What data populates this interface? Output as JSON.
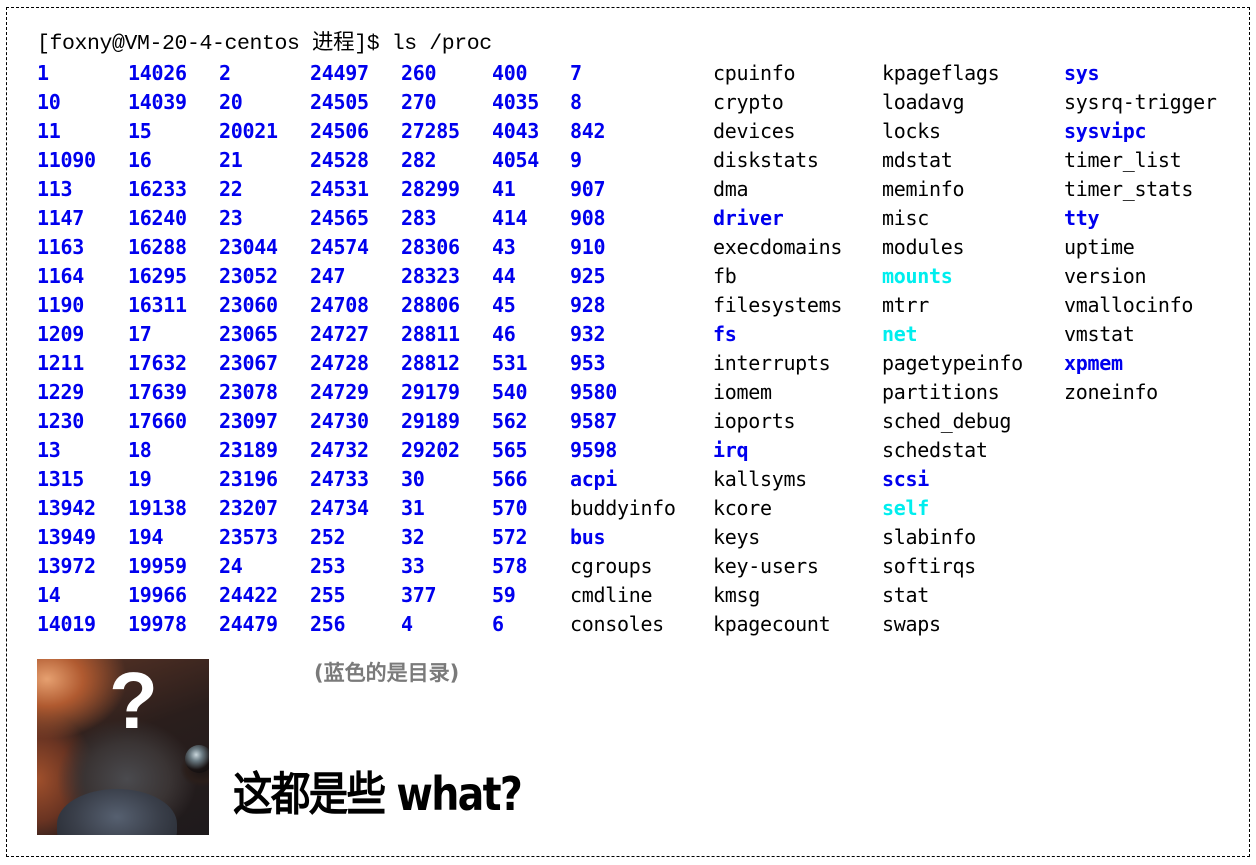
{
  "terminal": {
    "prompt": "[foxny@VM-20-4-centos 进程]$ ls /proc",
    "colors": {
      "file": "#000000",
      "directory": "#0000ee",
      "symlink": "#00eeee"
    },
    "columns": [
      [
        {
          "name": "1",
          "type": "dir"
        },
        {
          "name": "10",
          "type": "dir"
        },
        {
          "name": "11",
          "type": "dir"
        },
        {
          "name": "11090",
          "type": "dir"
        },
        {
          "name": "113",
          "type": "dir"
        },
        {
          "name": "1147",
          "type": "dir"
        },
        {
          "name": "1163",
          "type": "dir"
        },
        {
          "name": "1164",
          "type": "dir"
        },
        {
          "name": "1190",
          "type": "dir"
        },
        {
          "name": "1209",
          "type": "dir"
        },
        {
          "name": "1211",
          "type": "dir"
        },
        {
          "name": "1229",
          "type": "dir"
        },
        {
          "name": "1230",
          "type": "dir"
        },
        {
          "name": "13",
          "type": "dir"
        },
        {
          "name": "1315",
          "type": "dir"
        },
        {
          "name": "13942",
          "type": "dir"
        },
        {
          "name": "13949",
          "type": "dir"
        },
        {
          "name": "13972",
          "type": "dir"
        },
        {
          "name": "14",
          "type": "dir"
        },
        {
          "name": "14019",
          "type": "dir"
        }
      ],
      [
        {
          "name": "14026",
          "type": "dir"
        },
        {
          "name": "14039",
          "type": "dir"
        },
        {
          "name": "15",
          "type": "dir"
        },
        {
          "name": "16",
          "type": "dir"
        },
        {
          "name": "16233",
          "type": "dir"
        },
        {
          "name": "16240",
          "type": "dir"
        },
        {
          "name": "16288",
          "type": "dir"
        },
        {
          "name": "16295",
          "type": "dir"
        },
        {
          "name": "16311",
          "type": "dir"
        },
        {
          "name": "17",
          "type": "dir"
        },
        {
          "name": "17632",
          "type": "dir"
        },
        {
          "name": "17639",
          "type": "dir"
        },
        {
          "name": "17660",
          "type": "dir"
        },
        {
          "name": "18",
          "type": "dir"
        },
        {
          "name": "19",
          "type": "dir"
        },
        {
          "name": "19138",
          "type": "dir"
        },
        {
          "name": "194",
          "type": "dir"
        },
        {
          "name": "19959",
          "type": "dir"
        },
        {
          "name": "19966",
          "type": "dir"
        },
        {
          "name": "19978",
          "type": "dir"
        }
      ],
      [
        {
          "name": "2",
          "type": "dir"
        },
        {
          "name": "20",
          "type": "dir"
        },
        {
          "name": "20021",
          "type": "dir"
        },
        {
          "name": "21",
          "type": "dir"
        },
        {
          "name": "22",
          "type": "dir"
        },
        {
          "name": "23",
          "type": "dir"
        },
        {
          "name": "23044",
          "type": "dir"
        },
        {
          "name": "23052",
          "type": "dir"
        },
        {
          "name": "23060",
          "type": "dir"
        },
        {
          "name": "23065",
          "type": "dir"
        },
        {
          "name": "23067",
          "type": "dir"
        },
        {
          "name": "23078",
          "type": "dir"
        },
        {
          "name": "23097",
          "type": "dir"
        },
        {
          "name": "23189",
          "type": "dir"
        },
        {
          "name": "23196",
          "type": "dir"
        },
        {
          "name": "23207",
          "type": "dir"
        },
        {
          "name": "23573",
          "type": "dir"
        },
        {
          "name": "24",
          "type": "dir"
        },
        {
          "name": "24422",
          "type": "dir"
        },
        {
          "name": "24479",
          "type": "dir"
        }
      ],
      [
        {
          "name": "24497",
          "type": "dir"
        },
        {
          "name": "24505",
          "type": "dir"
        },
        {
          "name": "24506",
          "type": "dir"
        },
        {
          "name": "24528",
          "type": "dir"
        },
        {
          "name": "24531",
          "type": "dir"
        },
        {
          "name": "24565",
          "type": "dir"
        },
        {
          "name": "24574",
          "type": "dir"
        },
        {
          "name": "247",
          "type": "dir"
        },
        {
          "name": "24708",
          "type": "dir"
        },
        {
          "name": "24727",
          "type": "dir"
        },
        {
          "name": "24728",
          "type": "dir"
        },
        {
          "name": "24729",
          "type": "dir"
        },
        {
          "name": "24730",
          "type": "dir"
        },
        {
          "name": "24732",
          "type": "dir"
        },
        {
          "name": "24733",
          "type": "dir"
        },
        {
          "name": "24734",
          "type": "dir"
        },
        {
          "name": "252",
          "type": "dir"
        },
        {
          "name": "253",
          "type": "dir"
        },
        {
          "name": "255",
          "type": "dir"
        },
        {
          "name": "256",
          "type": "dir"
        }
      ],
      [
        {
          "name": "260",
          "type": "dir"
        },
        {
          "name": "270",
          "type": "dir"
        },
        {
          "name": "27285",
          "type": "dir"
        },
        {
          "name": "282",
          "type": "dir"
        },
        {
          "name": "28299",
          "type": "dir"
        },
        {
          "name": "283",
          "type": "dir"
        },
        {
          "name": "28306",
          "type": "dir"
        },
        {
          "name": "28323",
          "type": "dir"
        },
        {
          "name": "28806",
          "type": "dir"
        },
        {
          "name": "28811",
          "type": "dir"
        },
        {
          "name": "28812",
          "type": "dir"
        },
        {
          "name": "29179",
          "type": "dir"
        },
        {
          "name": "29189",
          "type": "dir"
        },
        {
          "name": "29202",
          "type": "dir"
        },
        {
          "name": "30",
          "type": "dir"
        },
        {
          "name": "31",
          "type": "dir"
        },
        {
          "name": "32",
          "type": "dir"
        },
        {
          "name": "33",
          "type": "dir"
        },
        {
          "name": "377",
          "type": "dir"
        },
        {
          "name": "4",
          "type": "dir"
        }
      ],
      [
        {
          "name": "400",
          "type": "dir"
        },
        {
          "name": "4035",
          "type": "dir"
        },
        {
          "name": "4043",
          "type": "dir"
        },
        {
          "name": "4054",
          "type": "dir"
        },
        {
          "name": "41",
          "type": "dir"
        },
        {
          "name": "414",
          "type": "dir"
        },
        {
          "name": "43",
          "type": "dir"
        },
        {
          "name": "44",
          "type": "dir"
        },
        {
          "name": "45",
          "type": "dir"
        },
        {
          "name": "46",
          "type": "dir"
        },
        {
          "name": "531",
          "type": "dir"
        },
        {
          "name": "540",
          "type": "dir"
        },
        {
          "name": "562",
          "type": "dir"
        },
        {
          "name": "565",
          "type": "dir"
        },
        {
          "name": "566",
          "type": "dir"
        },
        {
          "name": "570",
          "type": "dir"
        },
        {
          "name": "572",
          "type": "dir"
        },
        {
          "name": "578",
          "type": "dir"
        },
        {
          "name": "59",
          "type": "dir"
        },
        {
          "name": "6",
          "type": "dir"
        }
      ],
      [
        {
          "name": "7",
          "type": "dir"
        },
        {
          "name": "8",
          "type": "dir"
        },
        {
          "name": "842",
          "type": "dir"
        },
        {
          "name": "9",
          "type": "dir"
        },
        {
          "name": "907",
          "type": "dir"
        },
        {
          "name": "908",
          "type": "dir"
        },
        {
          "name": "910",
          "type": "dir"
        },
        {
          "name": "925",
          "type": "dir"
        },
        {
          "name": "928",
          "type": "dir"
        },
        {
          "name": "932",
          "type": "dir"
        },
        {
          "name": "953",
          "type": "dir"
        },
        {
          "name": "9580",
          "type": "dir"
        },
        {
          "name": "9587",
          "type": "dir"
        },
        {
          "name": "9598",
          "type": "dir"
        },
        {
          "name": "acpi",
          "type": "dir"
        },
        {
          "name": "buddyinfo",
          "type": "file"
        },
        {
          "name": "bus",
          "type": "dir"
        },
        {
          "name": "cgroups",
          "type": "file"
        },
        {
          "name": "cmdline",
          "type": "file"
        },
        {
          "name": "consoles",
          "type": "file"
        }
      ],
      [
        {
          "name": "cpuinfo",
          "type": "file"
        },
        {
          "name": "crypto",
          "type": "file"
        },
        {
          "name": "devices",
          "type": "file"
        },
        {
          "name": "diskstats",
          "type": "file"
        },
        {
          "name": "dma",
          "type": "file"
        },
        {
          "name": "driver",
          "type": "dir"
        },
        {
          "name": "execdomains",
          "type": "file"
        },
        {
          "name": "fb",
          "type": "file"
        },
        {
          "name": "filesystems",
          "type": "file"
        },
        {
          "name": "fs",
          "type": "dir"
        },
        {
          "name": "interrupts",
          "type": "file"
        },
        {
          "name": "iomem",
          "type": "file"
        },
        {
          "name": "ioports",
          "type": "file"
        },
        {
          "name": "irq",
          "type": "dir"
        },
        {
          "name": "kallsyms",
          "type": "file"
        },
        {
          "name": "kcore",
          "type": "file"
        },
        {
          "name": "keys",
          "type": "file"
        },
        {
          "name": "key-users",
          "type": "file"
        },
        {
          "name": "kmsg",
          "type": "file"
        },
        {
          "name": "kpagecount",
          "type": "file"
        }
      ],
      [
        {
          "name": "kpageflags",
          "type": "file"
        },
        {
          "name": "loadavg",
          "type": "file"
        },
        {
          "name": "locks",
          "type": "file"
        },
        {
          "name": "mdstat",
          "type": "file"
        },
        {
          "name": "meminfo",
          "type": "file"
        },
        {
          "name": "misc",
          "type": "file"
        },
        {
          "name": "modules",
          "type": "file"
        },
        {
          "name": "mounts",
          "type": "link"
        },
        {
          "name": "mtrr",
          "type": "file"
        },
        {
          "name": "net",
          "type": "link"
        },
        {
          "name": "pagetypeinfo",
          "type": "file"
        },
        {
          "name": "partitions",
          "type": "file"
        },
        {
          "name": "sched_debug",
          "type": "file"
        },
        {
          "name": "schedstat",
          "type": "file"
        },
        {
          "name": "scsi",
          "type": "dir"
        },
        {
          "name": "self",
          "type": "link"
        },
        {
          "name": "slabinfo",
          "type": "file"
        },
        {
          "name": "softirqs",
          "type": "file"
        },
        {
          "name": "stat",
          "type": "file"
        },
        {
          "name": "swaps",
          "type": "file"
        }
      ],
      [
        {
          "name": "sys",
          "type": "dir"
        },
        {
          "name": "sysrq-trigger",
          "type": "file"
        },
        {
          "name": "sysvipc",
          "type": "dir"
        },
        {
          "name": "timer_list",
          "type": "file"
        },
        {
          "name": "timer_stats",
          "type": "file"
        },
        {
          "name": "tty",
          "type": "dir"
        },
        {
          "name": "uptime",
          "type": "file"
        },
        {
          "name": "version",
          "type": "file"
        },
        {
          "name": "vmallocinfo",
          "type": "file"
        },
        {
          "name": "vmstat",
          "type": "file"
        },
        {
          "name": "xpmem",
          "type": "dir"
        },
        {
          "name": "zoneinfo",
          "type": "file"
        }
      ]
    ]
  },
  "annotation": {
    "caption": "(蓝色的是目录)",
    "meme_text": "这都是些 what?",
    "image_overlay": "?",
    "image_subject": "dog-face-meme"
  }
}
